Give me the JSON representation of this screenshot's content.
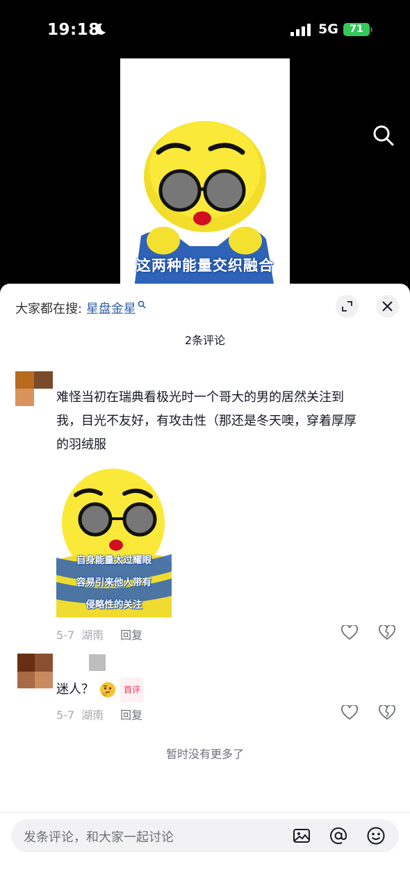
{
  "status_bar": {
    "time": "19:18",
    "network": "5G",
    "battery": "71"
  },
  "video": {
    "caption": "这两种能量交织融合"
  },
  "search_hint": {
    "prefix": "大家都在搜:",
    "keyword": "星盘金星"
  },
  "comments_count": "2条评论",
  "comments": [
    {
      "text_lines": [
        "难怪当初在瑞典看极光时一个哥大的男的居然关注到",
        "我，目光不友好，有攻击性（那还是冬天噢，穿着厚厚",
        "的羽绒服"
      ],
      "sticker_caption": [
        "自身能量太过耀眼",
        "容易引来他人带有",
        "侵略性的关注"
      ],
      "date": "5-7",
      "location": "湖南",
      "reply_label": "回复"
    },
    {
      "text": "迷人？",
      "badge": "首评",
      "date": "5-7",
      "location": "湖南",
      "reply_label": "回复"
    }
  ],
  "no_more": "暂时没有更多了",
  "input": {
    "placeholder": "发条评论，和大家一起讨论"
  },
  "colors": {
    "keyword": "#2d5fa8",
    "badge": "#fe2c55",
    "battery": "#34c759"
  }
}
